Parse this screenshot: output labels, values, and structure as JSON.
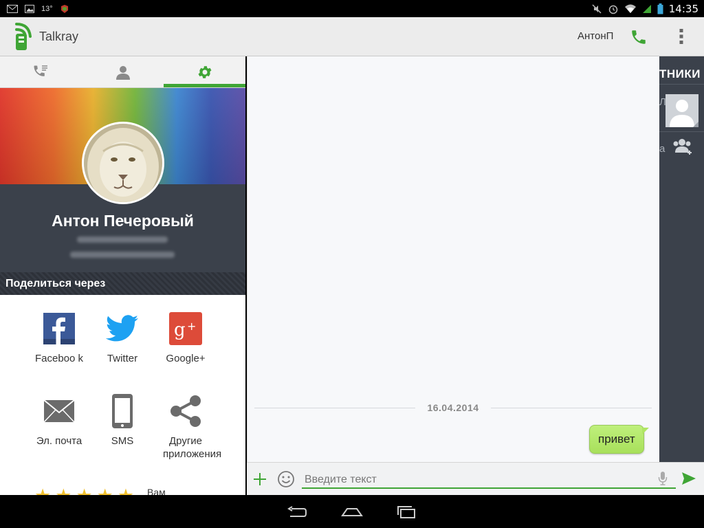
{
  "status_bar": {
    "temperature": "13°",
    "time": "14:35"
  },
  "action_bar": {
    "app_title": "Talkray",
    "contact_name": "АнтонП"
  },
  "tabs": [
    {
      "icon": "call-log-icon"
    },
    {
      "icon": "contact-icon"
    },
    {
      "icon": "settings-icon",
      "selected": true
    }
  ],
  "profile": {
    "name": "Антон Печеровый"
  },
  "share": {
    "header": "Поделиться через",
    "items": [
      {
        "label": "Faceboo k",
        "icon": "facebook-icon"
      },
      {
        "label": "Twitter",
        "icon": "twitter-icon"
      },
      {
        "label": "Google+",
        "icon": "google-plus-icon"
      },
      {
        "label": "Эл. почта",
        "icon": "mail-icon"
      },
      {
        "label": "SMS",
        "icon": "phone-icon"
      },
      {
        "label": "Другие приложения",
        "icon": "share-icon"
      }
    ],
    "rate_label": "Вам"
  },
  "chat": {
    "date": "16.04.2014",
    "message": "привет",
    "input_placeholder": "Введите текст"
  },
  "drawer": {
    "title": "тники",
    "letter_1": "Л",
    "letter_2": "а"
  },
  "colors": {
    "accent": "#3fa535",
    "dark_panel": "#3b414b",
    "bubble": "#b0e564"
  }
}
